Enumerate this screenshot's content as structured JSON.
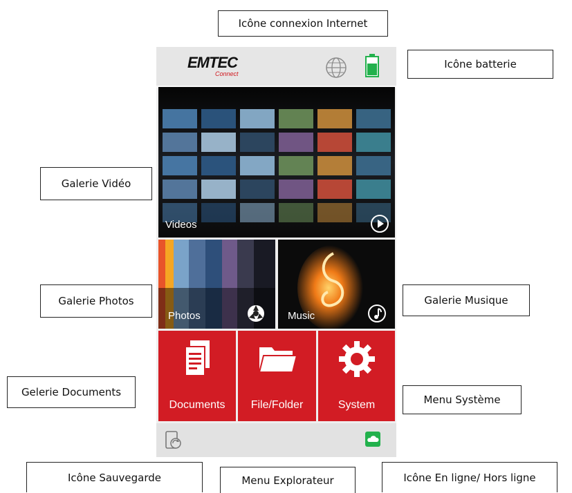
{
  "callouts": {
    "internet": "Icône connexion Internet",
    "battery": "Icône batterie",
    "video_gallery": "Galerie Vidéo",
    "photo_gallery": "Galerie Photos",
    "music_gallery": "Galerie Musique",
    "documents_gallery": "Gelerie Documents",
    "system_menu": "Menu Système",
    "backup": "Icône Sauvegarde",
    "explorer": "Menu Explorateur",
    "online": "Icône En ligne/ Hors ligne"
  },
  "app": {
    "logo": "EMTEC",
    "logo_sub": "Connect",
    "tiles": {
      "videos": "Videos",
      "photos": "Photos",
      "music": "Music",
      "documents": "Documents",
      "folder": "File/Folder",
      "system": "System"
    },
    "icons": {
      "internet": "globe-icon",
      "battery": "battery-icon",
      "play": "play-icon",
      "photo": "aperture-icon",
      "music": "music-note-icon",
      "documents": "documents-icon",
      "folder": "folder-icon",
      "system": "gear-icon",
      "backup": "backup-icon",
      "online": "cloud-icon"
    },
    "colors": {
      "accent_red": "#d21c24",
      "online_green": "#22b14c",
      "battery_green": "#22b14c"
    }
  }
}
